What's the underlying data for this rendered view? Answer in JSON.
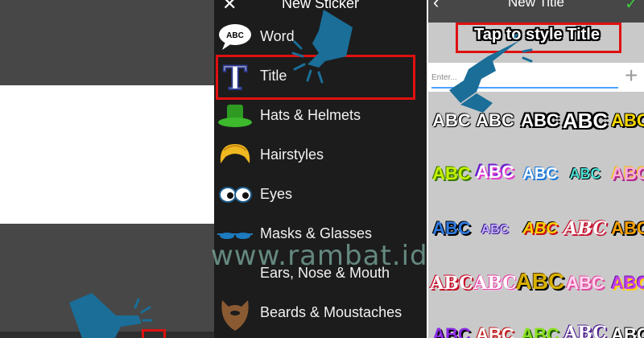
{
  "screen1": {},
  "screen2": {
    "close_icon": "✕",
    "title": "New Sticker",
    "items": [
      {
        "label": "Word",
        "icon": "speech-bubble-icon"
      },
      {
        "label": "Title",
        "icon": "title-letter-icon"
      },
      {
        "label": "Hats & Helmets",
        "icon": "green-hat-icon"
      },
      {
        "label": "Hairstyles",
        "icon": "blonde-hair-icon"
      },
      {
        "label": "Eyes",
        "icon": "cartoon-eyes-icon"
      },
      {
        "label": "Masks & Glasses",
        "icon": "blue-glasses-icon"
      },
      {
        "label": "Ears, Nose & Mouth",
        "icon": "face-parts-icon"
      },
      {
        "label": "Beards & Moustaches",
        "icon": "beard-icon"
      }
    ],
    "word_icon_text": "ABC",
    "title_icon_letter": "T"
  },
  "screen3": {
    "back_icon": "‹",
    "title": "New Title",
    "confirm_icon": "✓",
    "hint": "Tap to style Title",
    "input_placeholder": "Enter...",
    "add_icon": "+",
    "styles": [
      [
        "ABC",
        "ABC",
        "ABC",
        "ABC",
        "ABC"
      ],
      [
        "ABC",
        "ABC",
        "ABC",
        "ABC",
        "ABC"
      ],
      [
        "ABC",
        "ABC",
        "ABC",
        "ABC",
        "ABC"
      ],
      [
        "ABC",
        "ABC",
        "ABC",
        "ABC",
        "ABC"
      ],
      [
        "ABC",
        "ABC",
        "ABC",
        "ABC",
        "ABC"
      ]
    ]
  },
  "watermark": "www.rambat.id",
  "colors": {
    "highlight": "#e01010",
    "hand": "#1a6e98",
    "dark_panel": "#474747",
    "menu_bg": "#1c1c1c",
    "confirm": "#3ccf3c"
  }
}
